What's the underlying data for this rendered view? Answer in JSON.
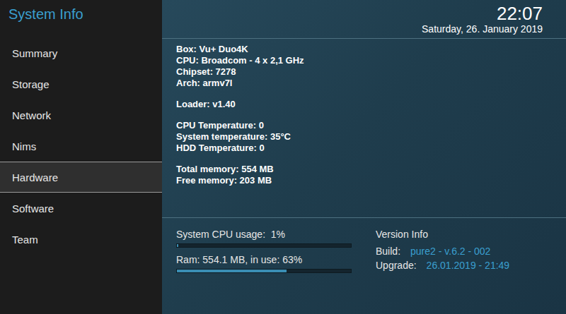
{
  "window": {
    "title": "System Info"
  },
  "clock": {
    "time": "22:07",
    "date": "Saturday, 26. January 2019"
  },
  "sidebar": {
    "items": [
      {
        "label": "Summary",
        "selected": false
      },
      {
        "label": "Storage",
        "selected": false
      },
      {
        "label": "Network",
        "selected": false
      },
      {
        "label": "Nims",
        "selected": false
      },
      {
        "label": "Hardware",
        "selected": true
      },
      {
        "label": "Software",
        "selected": false
      },
      {
        "label": "Team",
        "selected": false
      }
    ]
  },
  "info": {
    "groups": [
      [
        "Box: Vu+ Duo4K",
        "CPU: Broadcom - 4 x 2,1 GHz",
        "Chipset: 7278",
        "Arch: armv7l"
      ],
      [
        "Loader: v1.40"
      ],
      [
        "CPU Temperature: 0",
        "System temperature: 35°C",
        "HDD Temperature: 0"
      ],
      [
        "Total memory: 554 MB",
        "Free memory: 203 MB"
      ]
    ]
  },
  "usage": [
    {
      "text": "System CPU usage:  1%",
      "level": 0.01
    },
    {
      "text": "Ram: 554.1 MB, in use: 63%",
      "level": 0.63
    }
  ],
  "version": {
    "title": "Version Info",
    "rows": [
      {
        "label": "Build:",
        "value": "pure2 - v.6.2 - 002"
      },
      {
        "label": "Upgrade:",
        "value": "26.01.2019 - 21:49"
      }
    ]
  }
}
